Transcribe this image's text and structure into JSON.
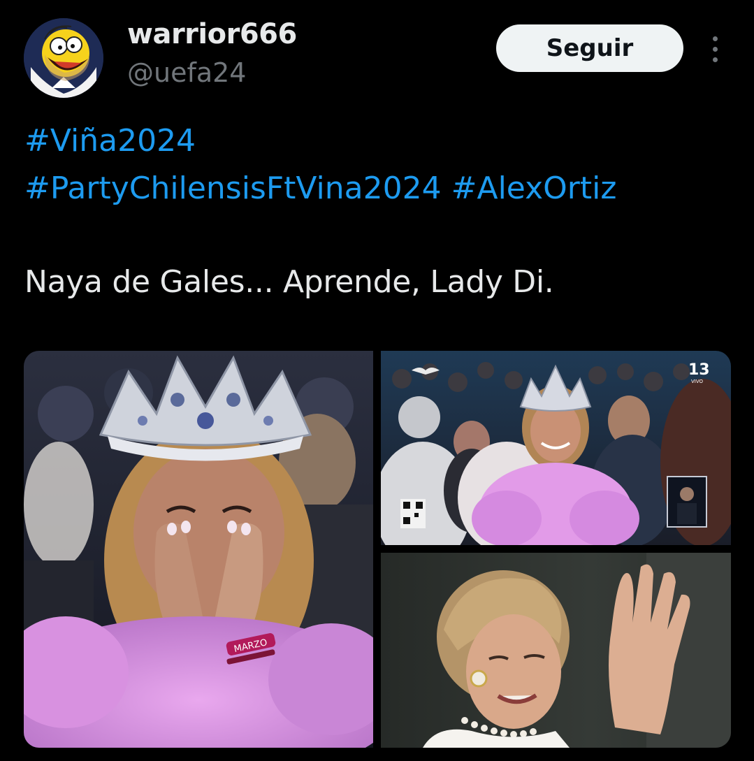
{
  "author": {
    "display_name": "warrior666",
    "handle": "@uefa24",
    "avatar_icon": "homer-avatar-icon"
  },
  "follow_button": {
    "label": "Seguir"
  },
  "more_icon": "more-vertical-icon",
  "tweet": {
    "hashtags_line1": [
      "#Viña2024"
    ],
    "hashtags_line2": [
      "#PartyChilensisFtVina2024",
      "#AlexOrtiz"
    ],
    "body": "Naya de Gales... Aprende, Lady Di."
  },
  "media": {
    "overlay_channel_badge": "13",
    "overlay_channel_sub": "VIVO",
    "wristband_text": "MARZO"
  },
  "colors": {
    "background": "#000000",
    "text": "#e7e9ea",
    "muted": "#71767b",
    "link": "#1d9bf0",
    "button_bg": "#eff3f4"
  }
}
